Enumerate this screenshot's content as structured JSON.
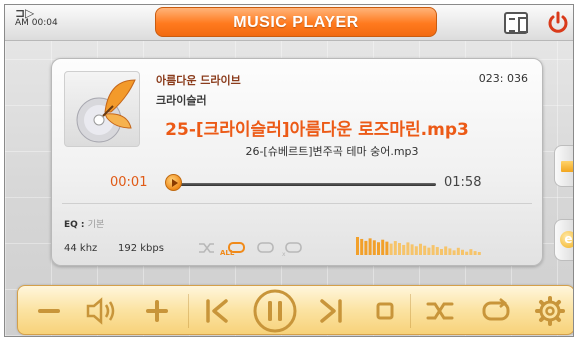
{
  "status": {
    "clock": "AM 00:04"
  },
  "title": "MUSIC PLAYER",
  "track": {
    "artist_line_1": "아름다운 드라이브",
    "artist_line_2": "크라이슬러",
    "counter": "023: 036",
    "current_song": "25-[크라이슬러]아름다운 로즈마린.mp3",
    "next_song": "26-[슈베르트]변주곡 테마 숭어.mp3",
    "elapsed": "00:01",
    "duration": "01:58",
    "progress": 0.01
  },
  "info": {
    "eq_label": "EQ :",
    "eq_value": "기본",
    "sample_rate": "44 khz",
    "bitrate": "192 kbps",
    "repeat_mode_label": "ALL"
  },
  "colors": {
    "accent": "#ff7a1e",
    "song": "#ec5a16",
    "control_bar": "#fbe3a2",
    "icon": "#c8953a"
  },
  "icons": {
    "top": [
      "battery-icon",
      "list-view-icon",
      "power-icon"
    ],
    "side": [
      "folder-icon",
      "explorer-icon"
    ],
    "controls": [
      "volume-down-icon",
      "speaker-icon",
      "volume-up-icon",
      "previous-icon",
      "pause-icon",
      "next-icon",
      "stop-icon",
      "shuffle-icon",
      "repeat-icon",
      "settings-icon"
    ]
  }
}
